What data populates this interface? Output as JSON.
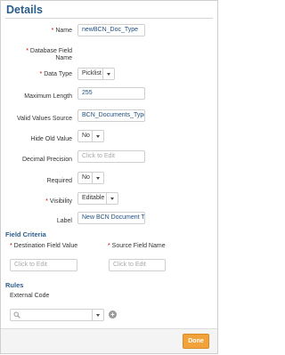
{
  "panel": {
    "title": "Details"
  },
  "fields": {
    "name": {
      "label": "Name",
      "value": "newBCN_Doc_Type"
    },
    "database_field_name": {
      "label": "Database Field Name"
    },
    "data_type": {
      "label": "Data Type",
      "value": "Picklist"
    },
    "maximum_length": {
      "label": "Maximum Length",
      "value": "255"
    },
    "valid_values_source": {
      "label": "Valid Values Source",
      "value": "BCN_Documents_Type"
    },
    "hide_old_value": {
      "label": "Hide Old Value",
      "value": "No"
    },
    "decimal_precision": {
      "label": "Decimal Precision",
      "placeholder": "Click to Edit"
    },
    "required": {
      "label": "Required",
      "value": "No"
    },
    "visibility": {
      "label": "Visibility",
      "value": "Editable"
    },
    "label": {
      "label": "Label",
      "value": "New BCN Document Ty"
    }
  },
  "field_criteria": {
    "title": "Field Criteria",
    "destination_label": "Destination Field Value",
    "destination_placeholder": "Click to Edit",
    "source_label": "Source Field Name",
    "source_placeholder": "Click to Edit"
  },
  "rules": {
    "title": "Rules",
    "external_code_label": "External Code"
  },
  "footer": {
    "done_label": "Done"
  },
  "icons": [
    "chevron-down-icon",
    "search-icon",
    "plus-circle-icon"
  ],
  "colors": {
    "heading": "#2b5d8a",
    "accent": "#f2a23a",
    "required": "#c00000"
  }
}
